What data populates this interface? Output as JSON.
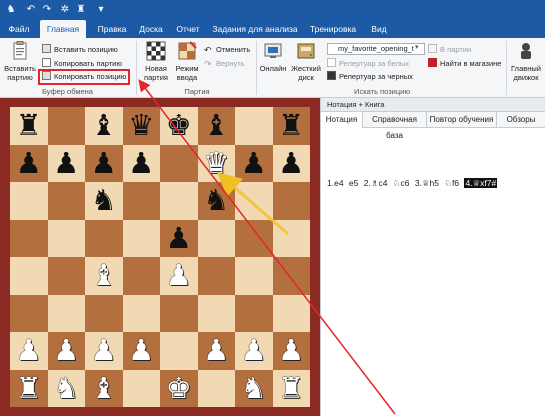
{
  "colors": {
    "titlebar": "#1d5aa6",
    "board_light": "#f1d9b3",
    "board_dark": "#b46f3f",
    "frame": "#8a2a22",
    "annotation": "#e3262c"
  },
  "quick_access": [
    "app-logo-icon",
    "undo-icon",
    "redo-icon",
    "settings-icon",
    "castle-icon",
    "dropdown-icon"
  ],
  "menu_tabs": [
    "Файл",
    "Главная",
    "Правка",
    "Доска",
    "Отчет",
    "Задания для анализа",
    "Тренировка",
    "Вид"
  ],
  "active_tab": "Главная",
  "ribbon": {
    "clipboard": {
      "paste_game": "Вставить\nпартию",
      "paste_position": "Вставить позицию",
      "copy_game": "Копировать партию",
      "copy_position": "Копировать позицию",
      "label": "Буфер обмена"
    },
    "game": {
      "new_game": "Новая\nпартия",
      "input_mode": "Режим\nввода",
      "cancel": "Отменить",
      "return": "Вернуть",
      "label": "Партия"
    },
    "search": {
      "online": "Онлайн",
      "hard_disk": "Жесткий\nдиск",
      "book_combo": "my_favorite_opening_t",
      "repertoire_white": "Репертуар за белых",
      "repertoire_black": "Репертуар за черных",
      "in_game": "В партии",
      "find_in_store": "Найти в магазине",
      "label": "Искать позицию"
    },
    "engine": {
      "main_engine": "Главный\nдвижок"
    }
  },
  "board": {
    "position": [
      [
        "bR",
        "",
        "bB",
        "bQ",
        "bK",
        "bB",
        "",
        "bR"
      ],
      [
        "bP",
        "bP",
        "bP",
        "bP",
        "",
        "wQ",
        "bP",
        "bP"
      ],
      [
        "",
        "",
        "bN",
        "",
        "",
        "bN",
        "",
        ""
      ],
      [
        "",
        "",
        "",
        "",
        "bP",
        "",
        "",
        ""
      ],
      [
        "",
        "",
        "wB",
        "",
        "wP",
        "",
        "",
        ""
      ],
      [
        "",
        "",
        "",
        "",
        "",
        "",
        "",
        ""
      ],
      [
        "wP",
        "wP",
        "wP",
        "wP",
        "",
        "wP",
        "wP",
        "wP"
      ],
      [
        "wR",
        "wN",
        "wB",
        "",
        "wK",
        "",
        "wN",
        "wR"
      ]
    ]
  },
  "panel": {
    "title": "Нотация + Книга",
    "tabs": [
      "Нотация",
      "Справочная база",
      "Повтор обучения",
      "Обзоры"
    ],
    "active_tab": "Нотация",
    "moves": [
      "1.e4",
      "e5",
      "2.♗c4",
      "♘c6",
      "3.♕h5",
      "♘f6",
      "4.♕xf7#"
    ]
  }
}
